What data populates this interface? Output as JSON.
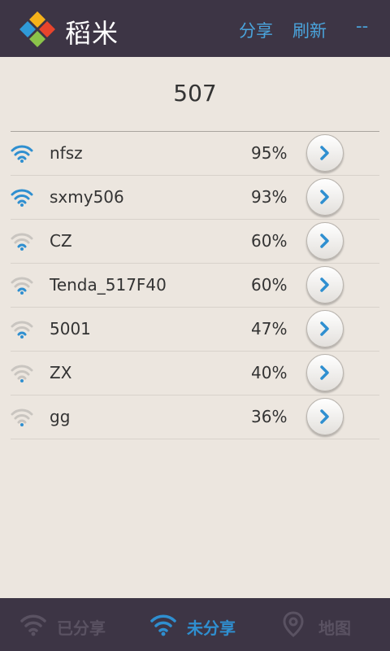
{
  "header": {
    "title": "稻米",
    "share_label": "分享",
    "refresh_label": "刷新",
    "more_label": "--"
  },
  "group": {
    "title": "507"
  },
  "networks": [
    {
      "ssid": "nfsz",
      "signal": "95%",
      "bars": 4
    },
    {
      "ssid": "sxmy506",
      "signal": "93%",
      "bars": 4
    },
    {
      "ssid": "CZ",
      "signal": "60%",
      "bars": 2
    },
    {
      "ssid": "Tenda_517F40",
      "signal": "60%",
      "bars": 2
    },
    {
      "ssid": "5001",
      "signal": "47%",
      "bars": 2
    },
    {
      "ssid": "ZX",
      "signal": "40%",
      "bars": 1
    },
    {
      "ssid": "gg",
      "signal": "36%",
      "bars": 1
    }
  ],
  "tabs": {
    "shared_label": "已分享",
    "unshared_label": "未分享",
    "map_label": "地图",
    "active": "unshared"
  },
  "colors": {
    "header_bg": "#3d3545",
    "accent": "#4aa4dc",
    "wifi_active": "#2f8fd0",
    "wifi_inactive": "#c9c5c0",
    "tab_inactive": "#5a5262",
    "page_bg": "#ece6df"
  },
  "icons": {
    "logo": "daomi-logo-icon",
    "wifi": "wifi-signal-icon",
    "go": "chevron-right-icon",
    "map": "map-pin-icon"
  }
}
